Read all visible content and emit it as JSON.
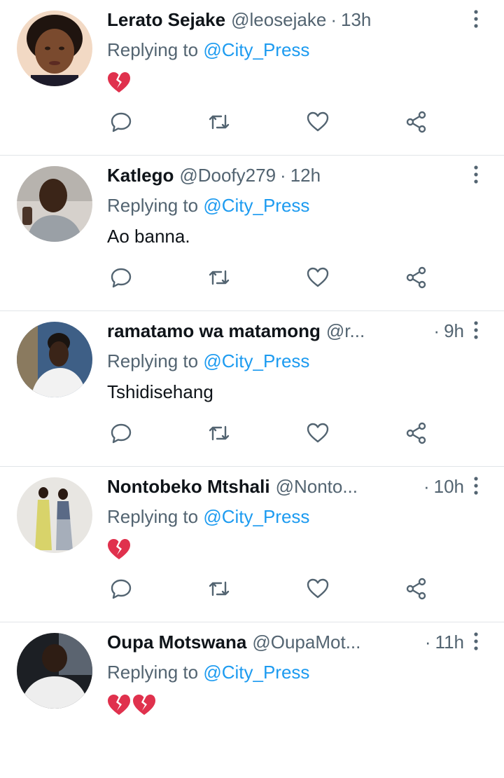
{
  "tweets": [
    {
      "name": "Lerato Sejake",
      "handle": "@leosejake",
      "sep": "·",
      "time": "13h",
      "reply_prefix": "Replying to",
      "reply_to": "@City_Press",
      "text": "",
      "emoji": "💔",
      "emoji_count": 1
    },
    {
      "name": "Katlego",
      "handle": "@Doofy279",
      "sep": "·",
      "time": "12h",
      "reply_prefix": "Replying to",
      "reply_to": "@City_Press",
      "text": "Ao banna.",
      "emoji": "",
      "emoji_count": 0
    },
    {
      "name": "ramatamo wa matamong",
      "handle": "@r...",
      "sep": "·",
      "time": "9h",
      "reply_prefix": "Replying to",
      "reply_to": "@City_Press",
      "text": "Tshidisehang",
      "emoji": "",
      "emoji_count": 0
    },
    {
      "name": "Nontobeko Mtshali",
      "handle": "@Nonto...",
      "sep": "·",
      "time": "10h",
      "reply_prefix": "Replying to",
      "reply_to": "@City_Press",
      "text": "",
      "emoji": "💔",
      "emoji_count": 1
    },
    {
      "name": "Oupa Motswana",
      "handle": "@OupaMot...",
      "sep": "·",
      "time": "11h",
      "reply_prefix": "Replying to",
      "reply_to": "@City_Press",
      "text": "",
      "emoji": "💔💔",
      "emoji_count": 2
    }
  ],
  "icons": {
    "reply": "reply-icon",
    "retweet": "retweet-icon",
    "like": "heart-icon",
    "share": "share-icon",
    "more": "more-vertical-icon",
    "broken_heart": "broken-heart-icon"
  },
  "colors": {
    "name": "#0f1419",
    "secondary": "#536471",
    "mention": "#1d9bf0",
    "divider": "#e1e5e8",
    "broken_heart": "#e0314d"
  }
}
